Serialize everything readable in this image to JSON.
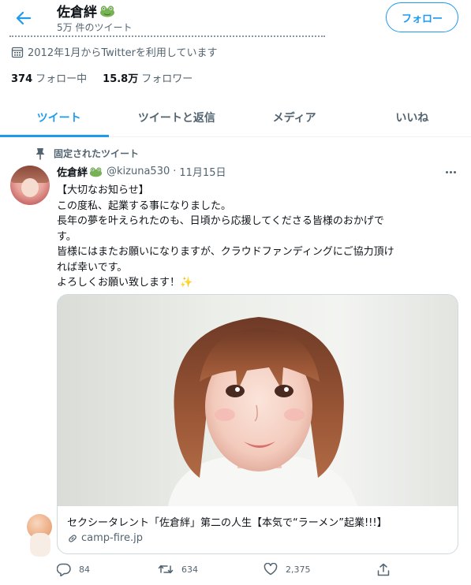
{
  "header": {
    "back_label": "",
    "profile_name": "佐倉絆",
    "tweet_count": "5万 件のツイート",
    "follow_button": "フォロー"
  },
  "profile": {
    "joined_text": "2012年1月からTwitterを利用しています",
    "following_count": "374",
    "following_label": "フォロー中",
    "followers_count": "15.8万",
    "followers_label": "フォロワー"
  },
  "tabs": [
    {
      "label": "ツイート",
      "active": true
    },
    {
      "label": "ツイートと返信",
      "active": false
    },
    {
      "label": "メディア",
      "active": false
    },
    {
      "label": "いいね",
      "active": false
    }
  ],
  "tweet": {
    "pinned_label": "固定されたツイート",
    "author_name": "佐倉絆",
    "handle": "@kizuna530",
    "separator": "·",
    "date": "11月15日",
    "lines": [
      "【大切なお知らせ】",
      "この度私、起業する事になりました。",
      "長年の夢を叶えられたのも、日頃から応援してくださる皆様のおかげで",
      "す。",
      "皆様にはまたお願いになりますが、クラウドファンディングにご協力頂け",
      "れば幸いです。",
      "よろしくお願い致します！"
    ],
    "sparkle": "✨",
    "card": {
      "caption": "セクシータレント「佐倉絆」第二の人生【本気で“ラーメン”起業!!!】",
      "domain": "camp-fire.jp"
    },
    "actions": {
      "replies": "84",
      "retweets": "634",
      "likes": "2,375"
    }
  },
  "icons": {
    "back": "arrow-left-icon",
    "frog": "frog-emoji-icon",
    "calendar": "calendar-icon",
    "pin": "pin-icon",
    "more": "more-icon",
    "link": "link-icon",
    "reply": "reply-icon",
    "retweet": "retweet-icon",
    "like": "heart-icon",
    "share": "share-icon"
  },
  "colors": {
    "accent": "#1d9bf0",
    "text": "#0f1419",
    "muted": "#536471",
    "border": "#cfd9de"
  }
}
